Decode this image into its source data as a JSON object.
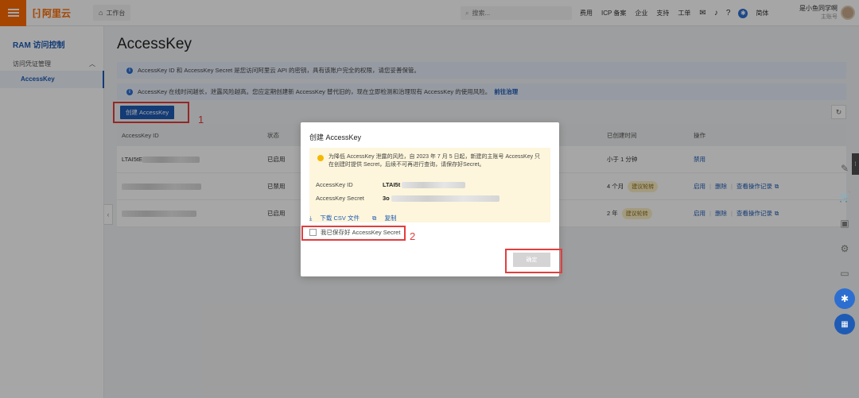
{
  "topbar": {
    "logo_mark": "[-]",
    "logo_text": "阿里云",
    "workbench_label": "工作台",
    "search_placeholder": "搜索...",
    "links": [
      "费用",
      "ICP 备案",
      "企业",
      "支持",
      "工单"
    ],
    "language": "简体",
    "user_name": "是小鱼同学啊",
    "user_role": "主账号"
  },
  "sidebar": {
    "title": "RAM 访问控制",
    "group": "访问凭证管理",
    "active_item": "AccessKey"
  },
  "main": {
    "title": "AccessKey",
    "notice1": "AccessKey ID 和 AccessKey Secret 是您访问阿里云 API 的密钥，具有该账户完全的权限，请您妥善保管。",
    "notice2": "AccessKey 在线时间越长，泄露风险越高。您应定期创建新 AccessKey 替代旧的，现在立即检测和治理现有 AccessKey 的使用风险。",
    "notice2_action": "前往治理",
    "create_button": "创建 AccessKey",
    "annotation_1": "1",
    "table": {
      "columns": [
        "AccessKey ID",
        "状态",
        "已创建时间",
        "操作"
      ],
      "rows": [
        {
          "id": "LTAI5tE",
          "status": "已启用",
          "created": "小于 1 分钟",
          "tag": "",
          "ops": [
            "禁用"
          ]
        },
        {
          "id": "",
          "status": "已禁用",
          "created": "4 个月",
          "tag": "建议轮转",
          "ops": [
            "启用",
            "删除",
            "查看操作记录"
          ]
        },
        {
          "id": "",
          "status": "已启用",
          "created": "2 年",
          "tag": "建议轮转",
          "ops": [
            "启用",
            "删除",
            "查看操作记录"
          ]
        }
      ]
    }
  },
  "dialog": {
    "title": "创建 AccessKey",
    "warning": "为降低 AccessKey 泄露的风险，自 2023 年 7 月 5 日起，新建的主账号 AccessKey 只在创建时提供 Secret，后续不可再进行查询，请保存好Secret。",
    "id_label": "AccessKey ID",
    "id_value": "LTAI5t",
    "secret_label": "AccessKey Secret",
    "secret_value": "3o",
    "download_csv": "下载 CSV 文件",
    "copy": "复制",
    "checkbox_label": "我已保存好 AccessKey Secret",
    "checkbox_checked": false,
    "ok_button": "确定",
    "annotation_2": "2"
  },
  "colors": {
    "brand": "#ff6a00",
    "primary": "#1e5bb5",
    "annotation": "#e43d3d"
  }
}
